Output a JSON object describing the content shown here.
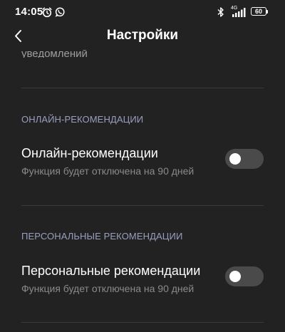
{
  "status_bar": {
    "time": "14:05",
    "network": "4G",
    "battery": "60"
  },
  "header": {
    "title": "Настройки"
  },
  "clipped_item": {
    "text": "уведомлений"
  },
  "sections": [
    {
      "header": "ОНЛАЙН-РЕКОМЕНДАЦИИ",
      "setting": {
        "title": "Онлайн-рекомендации",
        "summary": "Функция будет отключена на 90 дней",
        "enabled": false
      }
    },
    {
      "header": "ПЕРСОНАЛЬНЫЕ РЕКОМЕНДАЦИИ",
      "setting": {
        "title": "Персональные рекомендации",
        "summary": "Функция будет отключена на 90 дней",
        "enabled": false
      }
    }
  ],
  "colors": {
    "background": "#222222",
    "section_header": "#9a9fbf",
    "toggle_off": "#4a4a4a"
  }
}
